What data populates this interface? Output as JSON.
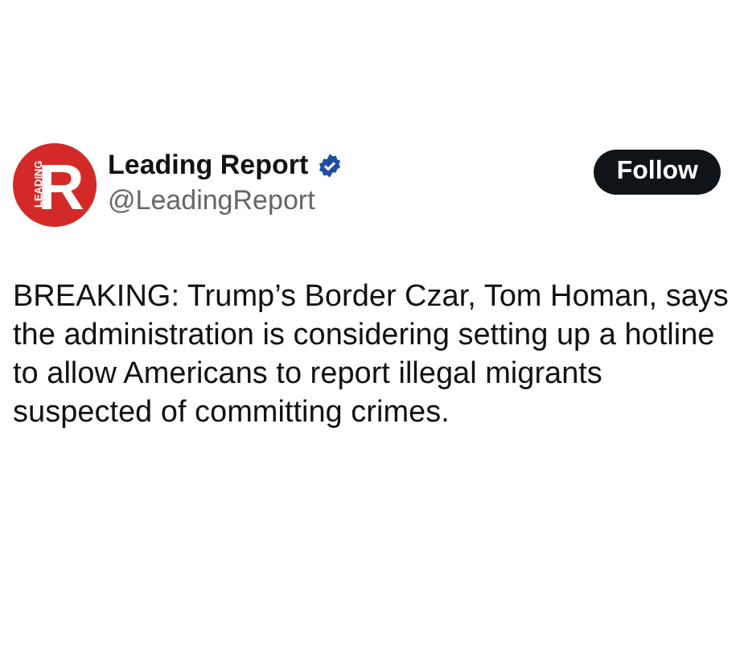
{
  "post": {
    "avatar": {
      "letter": "R",
      "word": "LEADING"
    },
    "author": {
      "name": "Leading Report",
      "verified": true,
      "handle": "@LeadingReport"
    },
    "follow_button": "Follow",
    "text": "BREAKING: Trump’s Border Czar, Tom Homan, says the administration is considering setting up a hotline to allow Americans to report illegal migrants suspected of committing crimes."
  }
}
